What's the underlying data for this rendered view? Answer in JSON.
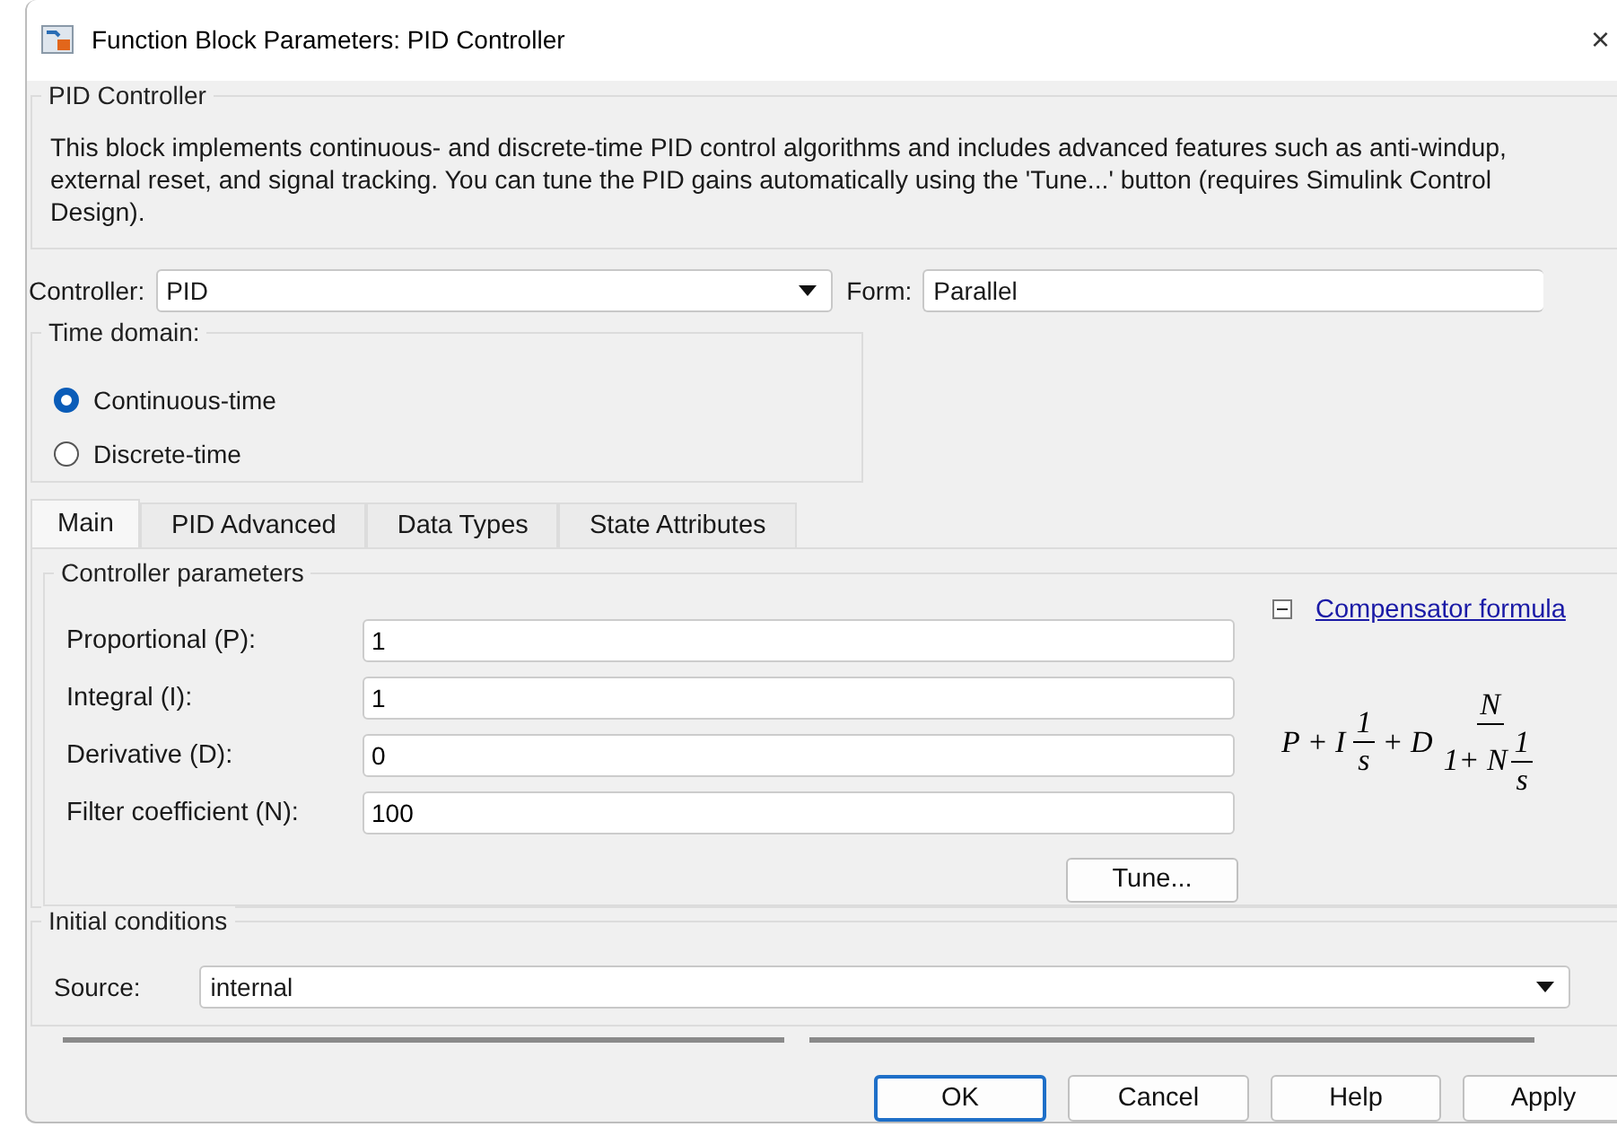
{
  "window": {
    "title": "Function Block Parameters: PID Controller",
    "close": "×"
  },
  "description": {
    "title": "PID Controller",
    "text": "This block implements continuous- and discrete-time PID control algorithms and includes advanced features such as anti-windup, external reset, and signal tracking. You can tune the PID gains automatically using the 'Tune...' button (requires Simulink Control Design)."
  },
  "controller": {
    "label": "Controller:",
    "value": "PID"
  },
  "form": {
    "label": "Form:",
    "value": "Parallel"
  },
  "time_domain": {
    "title": "Time domain:",
    "options": [
      {
        "label": "Continuous-time",
        "selected": true
      },
      {
        "label": "Discrete-time",
        "selected": false
      }
    ]
  },
  "tabs": [
    {
      "label": "Main",
      "selected": true
    },
    {
      "label": "PID Advanced",
      "selected": false
    },
    {
      "label": "Data Types",
      "selected": false
    },
    {
      "label": "State Attributes",
      "selected": false
    }
  ],
  "controller_parameters": {
    "title": "Controller parameters",
    "fields": [
      {
        "label": "Proportional (P):",
        "value": "1"
      },
      {
        "label": "Integral (I):",
        "value": "1"
      },
      {
        "label": "Derivative (D):",
        "value": "0"
      },
      {
        "label": "Filter coefficient (N):",
        "value": "100"
      }
    ],
    "tune_button": "Tune...",
    "formula_link": {
      "label": "Compensator formula",
      "expanded": true
    },
    "formula": [
      {
        "kind": "text",
        "text": "P + I"
      },
      {
        "kind": "frac",
        "num": [
          {
            "kind": "text",
            "text": "1"
          }
        ],
        "den": [
          {
            "kind": "text",
            "text": "s"
          }
        ]
      },
      {
        "kind": "text",
        "text": "+ D"
      },
      {
        "kind": "frac",
        "num": [
          {
            "kind": "text",
            "text": "N"
          }
        ],
        "den": [
          {
            "kind": "text",
            "text": "1+ N"
          },
          {
            "kind": "frac",
            "num": [
              {
                "kind": "text",
                "text": "1"
              }
            ],
            "den": [
              {
                "kind": "text",
                "text": "s"
              }
            ]
          }
        ]
      }
    ]
  },
  "initial_conditions": {
    "title": "Initial conditions",
    "source_label": "Source:",
    "source_value": "internal"
  },
  "buttons": [
    {
      "label": "OK",
      "focused": true
    },
    {
      "label": "Cancel",
      "focused": false
    },
    {
      "label": "Help",
      "focused": false
    },
    {
      "label": "Apply",
      "focused": false
    }
  ]
}
